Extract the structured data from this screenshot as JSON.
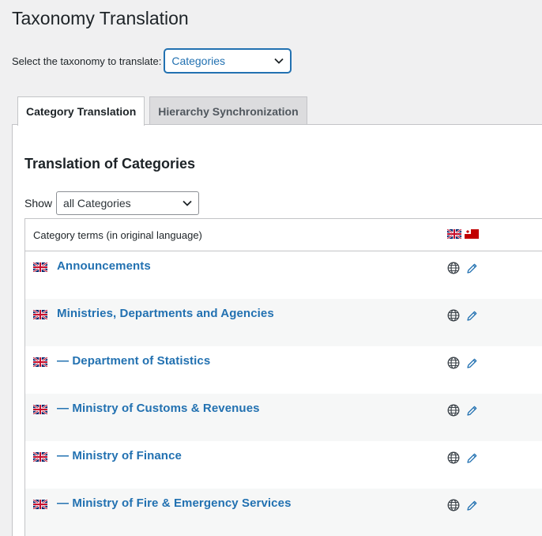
{
  "page": {
    "title": "Taxonomy Translation",
    "select_label": "Select the taxonomy to translate:",
    "selected_taxonomy": "Categories"
  },
  "tabs": [
    {
      "label": "Category Translation",
      "active": true
    },
    {
      "label": "Hierarchy Synchronization",
      "active": false
    }
  ],
  "section": {
    "title": "Translation of Categories",
    "show_label": "Show",
    "show_value": "all Categories"
  },
  "table": {
    "header": "Category terms (in original language)",
    "rows": [
      {
        "term": "Announcements"
      },
      {
        "term": "Ministries, Departments and Agencies"
      },
      {
        "term": "— Department of Statistics"
      },
      {
        "term": "— Ministry of Customs & Revenues"
      },
      {
        "term": "— Ministry of Finance"
      },
      {
        "term": "— Ministry of Fire & Emergency Services"
      }
    ]
  },
  "icons": {
    "flag_original": "uk-flag-icon",
    "flag_translation": "tonga-flag-icon",
    "translate": "globe-icon",
    "edit": "pencil-icon",
    "dropdown": "chevron-down-icon"
  },
  "colors": {
    "link": "#2271b1",
    "focus": "#2271b1"
  }
}
